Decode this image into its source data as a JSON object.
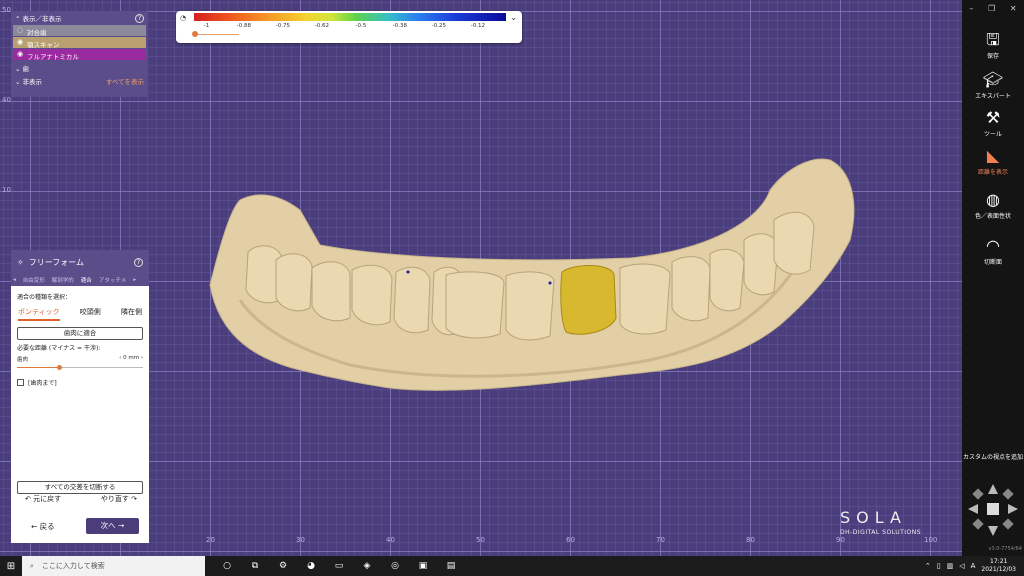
{
  "legend": {
    "ticks": [
      "-1",
      "-0.88",
      "-0.75",
      "-0.62",
      "-0.5",
      "-0.38",
      "-0.25",
      "-0.12"
    ],
    "gauge_icon": "gauge-icon",
    "chevron_icon": "chevron-down-icon"
  },
  "rulers": {
    "x": [
      "20",
      "30",
      "40",
      "50",
      "60",
      "70",
      "80",
      "90",
      "100"
    ],
    "y": [
      "50",
      "40",
      "10"
    ]
  },
  "visibility": {
    "title": "表示／非表示",
    "items": [
      {
        "label": "対合歯",
        "color": "#8a8a9a"
      },
      {
        "label": "顎スキャン",
        "color": "#b8a070"
      },
      {
        "label": "フルアナトミカル",
        "color": "#9a2aa0"
      }
    ],
    "teeth_section": "歯",
    "hidden_section": "非表示",
    "show_all": "すべてを表示"
  },
  "freeform": {
    "title": "フリーフォーム",
    "tabs": [
      "自由変形",
      "解剖学的",
      "適合",
      "アタッチメ"
    ],
    "active_tab": 2,
    "select_label": "適合の種類を選択：",
    "types": [
      "ポンティック",
      "咬頭側",
      "隣在側"
    ],
    "selected_type": 0,
    "fit_gum_button": "歯肉に適合",
    "distance_label": "必要な距離 (マイナス = 干渉):",
    "slider_name": "歯肉",
    "slider_value": "0 mm",
    "slider_fraction": 0.35,
    "checkbox_label": "[歯肉まで]",
    "cut_all_button": "すべての交差を切断する",
    "undo": "元に戻す",
    "redo": "やり直す",
    "back": "戻る",
    "next": "次へ"
  },
  "toolbar": {
    "items": [
      {
        "label": "保存",
        "icon": "save-icon"
      },
      {
        "label": "エキスパート",
        "icon": "expert-cap-icon"
      },
      {
        "label": "ツール",
        "icon": "tools-icon"
      },
      {
        "label": "距離を表示",
        "icon": "distance-icon",
        "active": true
      },
      {
        "label": "色／表面性状",
        "icon": "palette-icon"
      },
      {
        "label": "切断面",
        "icon": "cut-plane-icon"
      }
    ],
    "custom_view": "カスタムの視点を追加",
    "version": "v3.0-7754/64"
  },
  "logo": {
    "main": "SOLA",
    "sub": "DH-DIGITAL SOLUTIONS"
  },
  "taskbar": {
    "search_placeholder": "ここに入力して検索",
    "time": "17:21",
    "date": "2021/12/03",
    "ime": "A"
  },
  "colors": {
    "accent": "#e0622a",
    "panel": "#5a4d8a",
    "viewport": "#4b3e7d",
    "gum": "#e2cfa6",
    "crown": "#d8b82e"
  }
}
